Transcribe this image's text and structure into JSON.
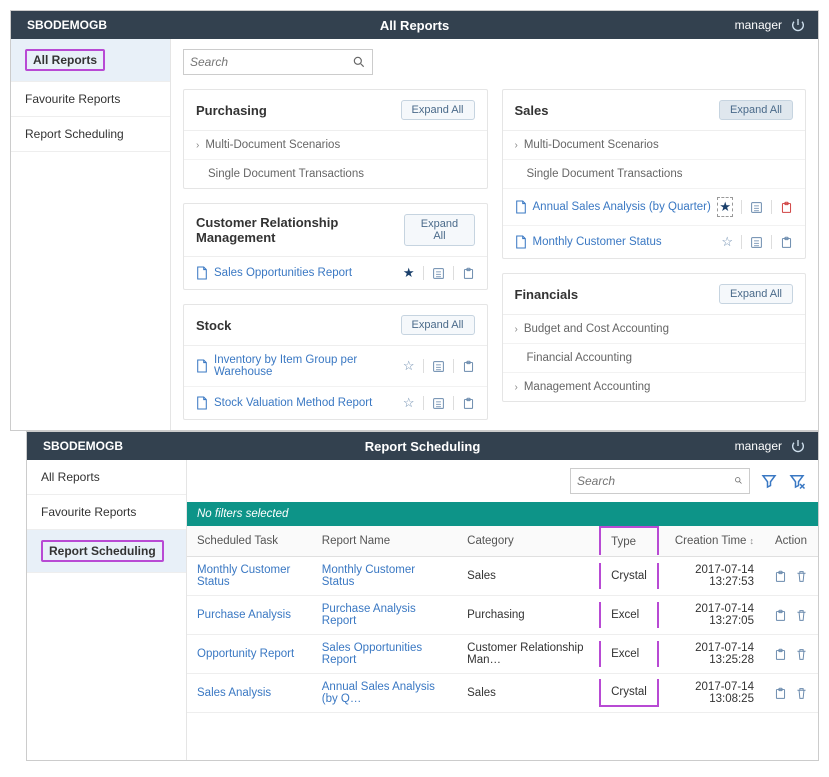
{
  "s1": {
    "brand": "SBODEMOGB",
    "title": "All Reports",
    "user": "manager",
    "sidebar": [
      {
        "label": "All Reports",
        "active": true,
        "highlight": true
      },
      {
        "label": "Favourite Reports"
      },
      {
        "label": "Report Scheduling"
      }
    ],
    "search_placeholder": "Search",
    "expand_label": "Expand All",
    "left_panels": [
      {
        "title": "Purchasing",
        "rows": [
          {
            "kind": "chev",
            "text": "Multi-Document Scenarios"
          },
          {
            "kind": "plain",
            "text": "Single Document Transactions"
          }
        ]
      },
      {
        "title": "Customer Relationship Management",
        "rows": [
          {
            "kind": "report",
            "text": "Sales Opportunities Report",
            "star": "filled"
          }
        ]
      },
      {
        "title": "Stock",
        "rows": [
          {
            "kind": "report",
            "text": "Inventory by Item Group per Warehouse",
            "star": "empty"
          },
          {
            "kind": "report",
            "text": "Stock Valuation Method Report",
            "star": "empty"
          }
        ]
      }
    ],
    "right_panels": [
      {
        "title": "Sales",
        "expand_active": true,
        "rows": [
          {
            "kind": "chev",
            "text": "Multi-Document Scenarios"
          },
          {
            "kind": "plain",
            "text": "Single Document Transactions"
          },
          {
            "kind": "report",
            "text": "Annual Sales Analysis (by Quarter)",
            "star": "filled",
            "dashed_star": true,
            "red_dot": true
          },
          {
            "kind": "report",
            "text": "Monthly Customer Status",
            "star": "empty"
          }
        ]
      },
      {
        "title": "Financials",
        "rows": [
          {
            "kind": "chev",
            "text": "Budget and Cost Accounting"
          },
          {
            "kind": "plain",
            "text": "Financial Accounting"
          },
          {
            "kind": "chev",
            "text": "Management Accounting"
          }
        ]
      }
    ]
  },
  "s2": {
    "brand": "SBODEMOGB",
    "title": "Report Scheduling",
    "user": "manager",
    "sidebar": [
      {
        "label": "All Reports"
      },
      {
        "label": "Favourite Reports"
      },
      {
        "label": "Report Scheduling",
        "active": true,
        "highlight": true
      }
    ],
    "search_placeholder": "Search",
    "no_filters": "No filters selected",
    "columns": [
      "Scheduled Task",
      "Report Name",
      "Category",
      "Type",
      "Creation Time",
      "Action"
    ],
    "sort_col": 4,
    "rows": [
      {
        "task": "Monthly Customer Status",
        "report": "Monthly Customer Status",
        "category": "Sales",
        "type": "Crystal",
        "time": "2017-07-14 13:27:53"
      },
      {
        "task": "Purchase Analysis",
        "report": "Purchase Analysis Report",
        "category": "Purchasing",
        "type": "Excel",
        "time": "2017-07-14 13:27:05"
      },
      {
        "task": "Opportunity Report",
        "report": "Sales Opportunities Report",
        "category": "Customer Relationship Man…",
        "type": "Excel",
        "time": "2017-07-14 13:25:28"
      },
      {
        "task": "Sales Analysis",
        "report": "Annual Sales Analysis (by Q…",
        "category": "Sales",
        "type": "Crystal",
        "time": "2017-07-14 13:08:25"
      }
    ]
  }
}
